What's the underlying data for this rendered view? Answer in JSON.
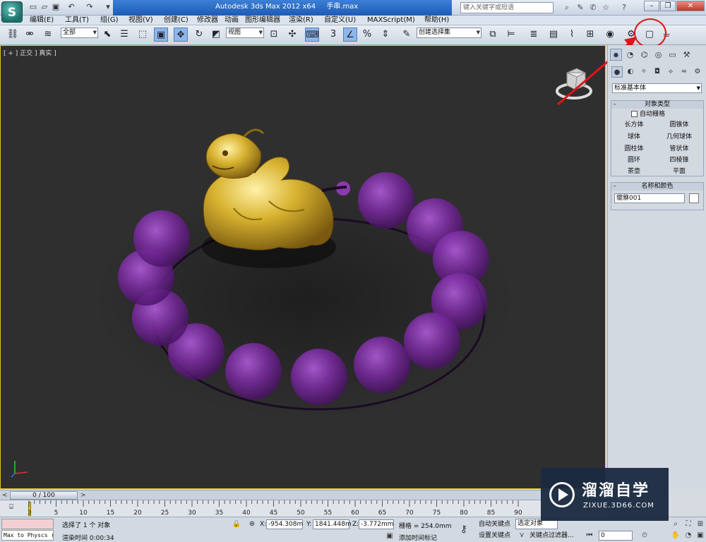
{
  "title_bar": {
    "app_title": "Autodesk 3ds Max  2012 x64",
    "file_name": "手串.max",
    "search_placeholder": "键入关键字或短语"
  },
  "menu": [
    {
      "label": "编辑(E)"
    },
    {
      "label": "工具(T)"
    },
    {
      "label": "组(G)"
    },
    {
      "label": "视图(V)"
    },
    {
      "label": "创建(C)"
    },
    {
      "label": "修改器"
    },
    {
      "label": "动画"
    },
    {
      "label": "图形编辑器"
    },
    {
      "label": "渲染(R)"
    },
    {
      "label": "自定义(U)"
    },
    {
      "label": "MAXScript(M)"
    },
    {
      "label": "帮助(H)"
    }
  ],
  "toolbar": {
    "selection_filter": "全部",
    "reference_coord": "视图",
    "snap_label": "3",
    "named_selection": "创建选择集"
  },
  "viewport": {
    "label": "[ + ] 正交 ] 真实 ]",
    "bg_color": "#2f2f2f",
    "bead_color": "#7a2aa0",
    "pixiu_color": "#d8b330"
  },
  "command_panel": {
    "category": "标准基本体",
    "object_type_title": "对象类型",
    "autogrid_label": "自动栅格",
    "object_buttons": [
      "长方体",
      "圆锥体",
      "球体",
      "几何球体",
      "圆柱体",
      "管状体",
      "圆环",
      "四棱锥",
      "茶壶",
      "平面"
    ],
    "name_color_title": "名称和颜色",
    "object_name": "貔貅001"
  },
  "time_slider": {
    "frame_display": "0 / 100"
  },
  "track_bar": {
    "tick_labels": [
      "0",
      "5",
      "10",
      "15",
      "20",
      "25",
      "30",
      "35",
      "40",
      "45",
      "50",
      "55",
      "60",
      "65",
      "70",
      "75",
      "80",
      "85",
      "90"
    ]
  },
  "status_bar": {
    "maxscript_text": "Max to Physcs (",
    "selection_status": "选择了 1 个 对象",
    "render_time": "渲染时间  0:00:34",
    "x_label": "X:",
    "x_value": "-954.308m",
    "y_label": "Y:",
    "y_value": "1841.448m",
    "z_label": "Z:",
    "z_value": "-3.772mm",
    "grid_label": "栅格 = 254.0mm",
    "add_time_tag": "添加时间标记",
    "auto_key": "自动关键点",
    "set_key": "设置关键点",
    "selected_set": "选定对象",
    "key_filters": "关键点过滤器...",
    "frame_value": "0"
  },
  "watermark": {
    "title": "溜溜自学",
    "url": "ZIXUE.3D66.COM"
  }
}
